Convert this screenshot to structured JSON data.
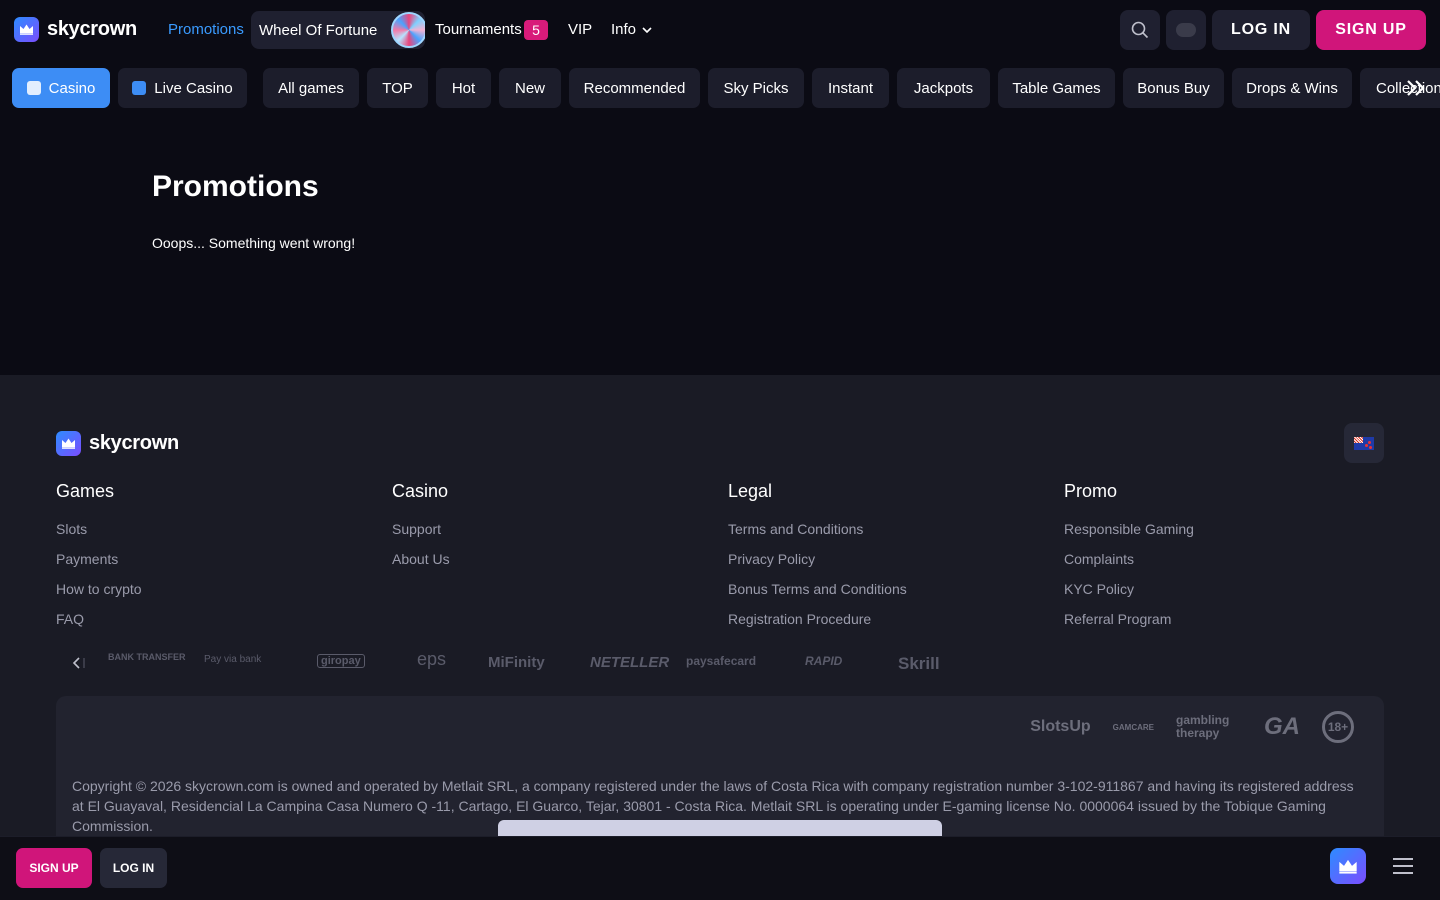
{
  "header": {
    "logo_text": "skycrown",
    "nav": {
      "promotions": "Promotions",
      "wheel": "Wheel Of Fortune",
      "tournaments": "Tournaments",
      "tournaments_count": "5",
      "vip": "VIP",
      "info": "Info"
    },
    "login_label": "LOG IN",
    "signup_label": "SIGN UP"
  },
  "categories": {
    "casino": "Casino",
    "live_casino": "Live Casino",
    "items": [
      "All games",
      "TOP",
      "Hot",
      "New",
      "Recommended",
      "Sky Picks",
      "Instant",
      "Jackpots",
      "Table Games",
      "Bonus Buy",
      "Drops & Wins",
      "Collections"
    ]
  },
  "main": {
    "title": "Promotions",
    "message": "Ooops... Something went wrong!"
  },
  "footer": {
    "logo_text": "skycrown",
    "columns": [
      {
        "title": "Games",
        "links": [
          "Slots",
          "Payments",
          "How to crypto",
          "FAQ"
        ]
      },
      {
        "title": "Casino",
        "links": [
          "Support",
          "About Us"
        ]
      },
      {
        "title": "Legal",
        "links": [
          "Terms and Conditions",
          "Privacy Policy",
          "Bonus Terms and Conditions",
          "Registration Procedure"
        ]
      },
      {
        "title": "Promo",
        "links": [
          "Responsible Gaming",
          "Complaints",
          "KYC Policy",
          "Referral Program"
        ]
      }
    ],
    "payments": [
      "BANK TRANSFER",
      "Pay via bank",
      "giropay",
      "eps",
      "MiFinity",
      "NETELLER",
      "paysafecard",
      "RAPID",
      "Skrill"
    ],
    "certs": [
      "SlotsUp",
      "GAMCARE",
      "gambling therapy",
      "GA",
      "18+"
    ],
    "copyright": "Copyright © 2026 skycrown.com is owned and operated by Metlait SRL, a company registered under the laws of Costa Rica with company registration number 3-102-911867 and having its registered address at El Guayaval, Residencial La Campina Casa Numero Q -11, Cartago, El Guarco, Tejar, 30801 - Costa Rica. Metlait SRL is operating under E-gaming license No. 0000064 issued by the Tobique Gaming Commission."
  },
  "bottom_bar": {
    "signup_label": "SIGN UP",
    "login_label": "LOG IN"
  },
  "colors": {
    "accent_blue": "#3d8df5",
    "brand_pink": "#d0157a",
    "background": "#0b0b14",
    "footer_bg": "#1a1b25"
  }
}
